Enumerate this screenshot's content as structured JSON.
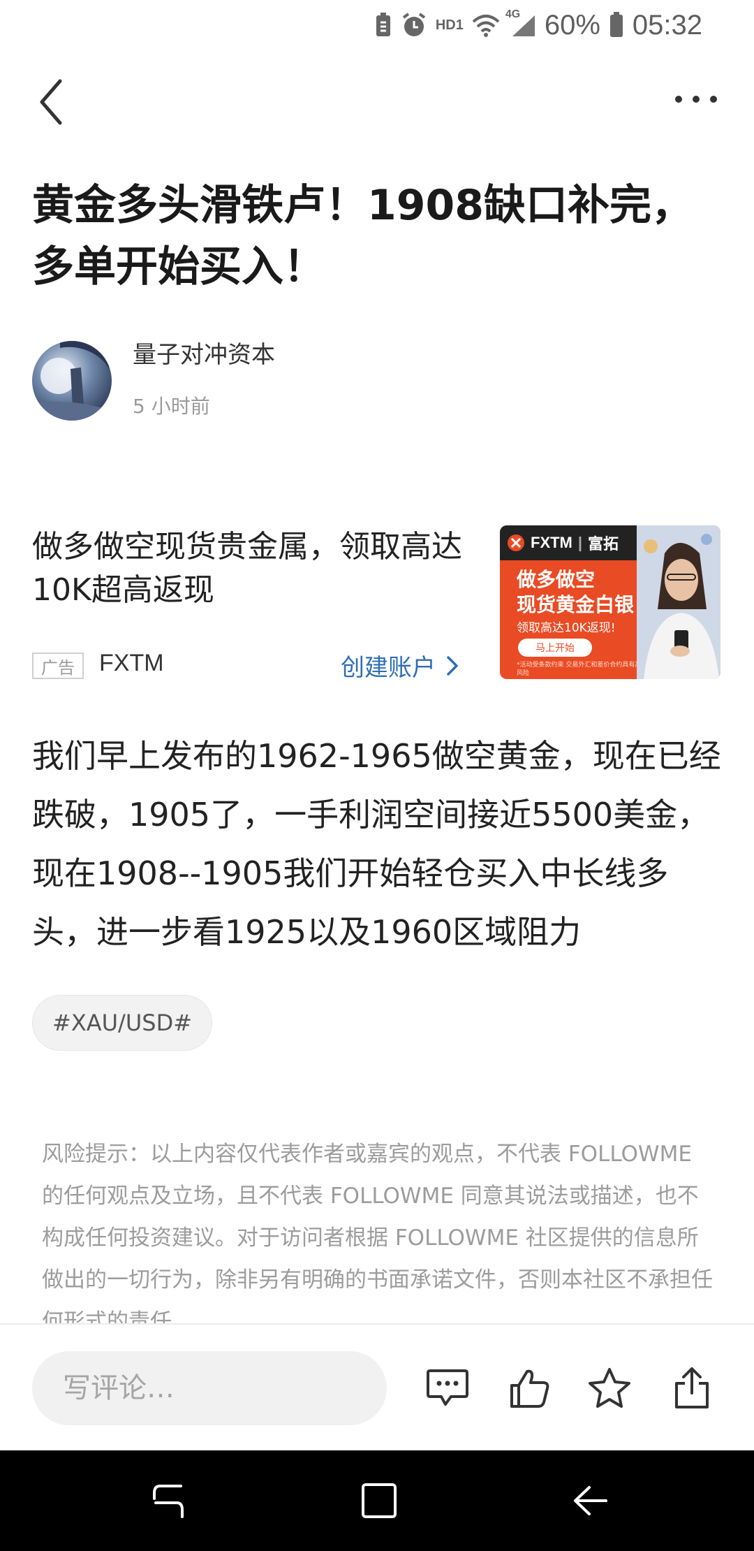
{
  "status_bar": {
    "hd_label": "HD1",
    "network_label": "4G",
    "battery_percent": "60%",
    "time": "05:32",
    "icons": [
      "battery-saver-icon",
      "alarm-icon",
      "wifi-icon",
      "signal-icon",
      "battery-icon"
    ]
  },
  "nav": {
    "back_icon": "chevron-left-icon",
    "more_icon": "more-horizontal-icon"
  },
  "article": {
    "title": "黄金多头滑铁卢！1908缺口补完，多单开始买入！",
    "author": "量子对冲资本",
    "time_ago": "5 小时前",
    "body": "我们早上发布的1962-1965做空黄金，现在已经跌破，1905了，一手利润空间接近5500美金，现在1908--1905我们开始轻仓买入中长线多头，进一步看1925以及1960区域阻力",
    "tag": "#XAU/USD#"
  },
  "ad": {
    "title": "做多做空现货贵金属，领取高达10K超高返现",
    "badge": "广告",
    "brand": "FXTM",
    "cta": "创建账户",
    "image": {
      "logo_text": "FXTM",
      "logo_cn": "富拓",
      "headline_1": "做多做空",
      "headline_2": "现货黄金白银",
      "subline": "领取高达10K返现!",
      "button": "马上开始",
      "fine_print": "*活动受条款约束 交易外汇和差价合约具有高风险"
    },
    "accent": "#e94b24"
  },
  "disclaimer": "风险提示：以上内容仅代表作者或嘉宾的观点，不代表 FOLLOWME 的任何观点及立场，且不代表 FOLLOWME 同意其说法或描述，也不构成任何投资建议。对于访问者根据 FOLLOWME 社区提供的信息所做出的一切行为，除非另有明确的书面承诺文件，否则本社区不承担任何形式的责任。",
  "bottom_bar": {
    "comment_placeholder": "写评论…",
    "icons": [
      "comment-icon",
      "like-icon",
      "favorite-star-icon",
      "share-icon"
    ]
  },
  "system_nav": {
    "icons": [
      "recent-apps-icon",
      "home-icon",
      "back-icon"
    ]
  },
  "colors": {
    "link_blue": "#2f6eb4",
    "text_dark": "#1a1a1a",
    "muted": "#9c9c9c"
  }
}
